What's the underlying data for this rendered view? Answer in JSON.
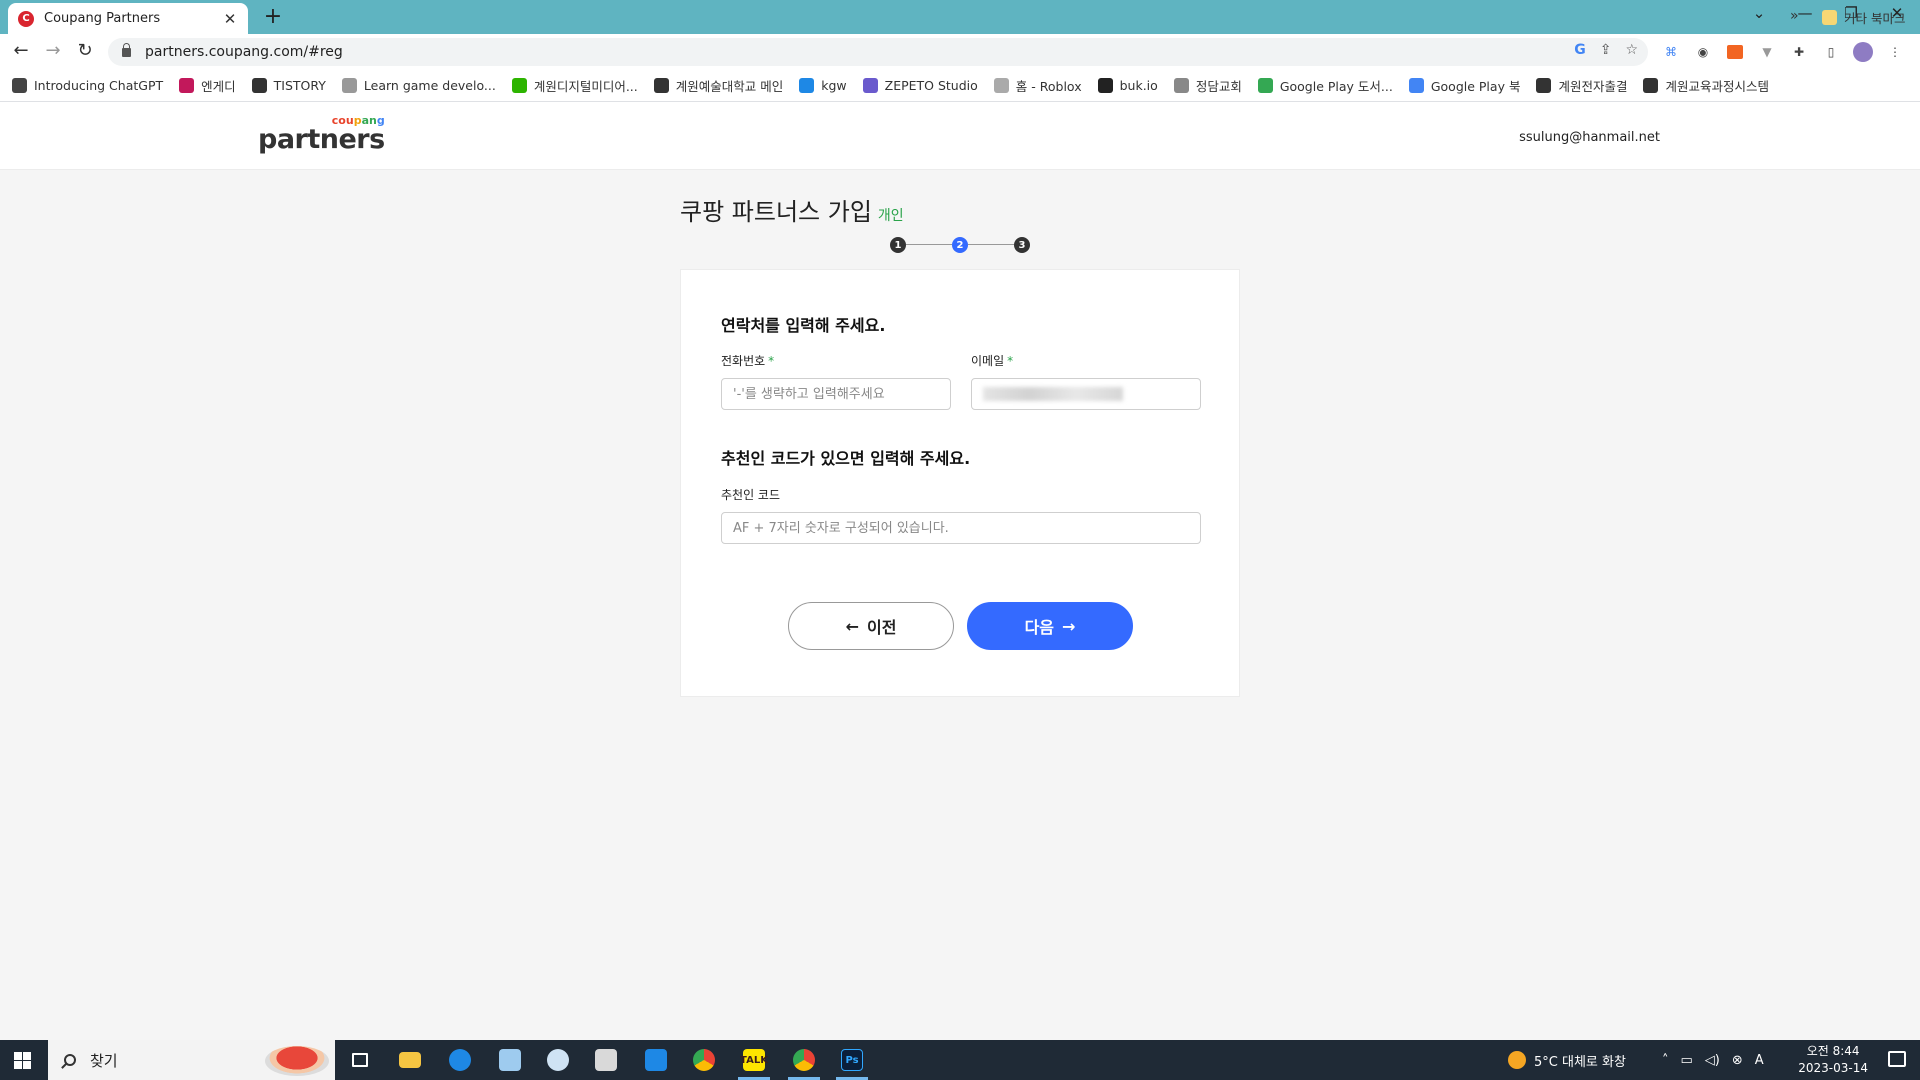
{
  "browser": {
    "tab_title": "Coupang Partners",
    "favicon_letter": "C",
    "close_symbol": "✕",
    "new_tab_symbol": "+",
    "url": "partners.coupang.com/#reg",
    "bookmarks": [
      {
        "label": "Introducing ChatGPT",
        "color": "#444"
      },
      {
        "label": "엔게디",
        "color": "#c2185b"
      },
      {
        "label": "TISTORY",
        "color": "#333"
      },
      {
        "label": "Learn game develo...",
        "color": "#999"
      },
      {
        "label": "계원디지털미디어...",
        "color": "#2db400"
      },
      {
        "label": "계원예술대학교 메인",
        "color": "#333"
      },
      {
        "label": "kgw",
        "color": "#1e88e5"
      },
      {
        "label": "ZEPETO Studio",
        "color": "#6a5acd"
      },
      {
        "label": "홈 - Roblox",
        "color": "#aaa"
      },
      {
        "label": "buk.io",
        "color": "#222"
      },
      {
        "label": "정담교회",
        "color": "#888"
      },
      {
        "label": "Google Play 도서...",
        "color": "#34a853"
      },
      {
        "label": "Google Play 북",
        "color": "#4285f4"
      },
      {
        "label": "계원전자출결",
        "color": "#333"
      },
      {
        "label": "계원교육과정시스템",
        "color": "#333"
      }
    ],
    "bookmark_more": "»",
    "other_bookmarks": "기타 북마크"
  },
  "header": {
    "logo_sub": "coupang",
    "logo_main": "partners",
    "user_email": "ssulung@hanmail.net"
  },
  "page": {
    "title": "쿠팡 파트너스 가입",
    "title_tag": "개인",
    "steps": [
      {
        "num": "1",
        "color": "#333"
      },
      {
        "num": "2",
        "color": "#346aff"
      },
      {
        "num": "3",
        "color": "#333"
      }
    ],
    "contact_heading": "연락처를 입력해 주세요.",
    "phone_label": "전화번호",
    "phone_placeholder": "'-'를 생략하고 입력해주세요",
    "phone_value": "",
    "email_label": "이메일",
    "required_mark": "*",
    "referral_heading": "추천인 코드가 있으면 입력해 주세요.",
    "referral_label": "추천인 코드",
    "referral_placeholder": "AF + 7자리 숫자로 구성되어 있습니다.",
    "referral_value": "",
    "prev_label": "이전",
    "next_label": "다음",
    "prev_arrow": "←",
    "next_arrow": "→"
  },
  "colors": {
    "brand_blue": "#346aff",
    "green": "#2aa34a",
    "tab_bar": "#5fb4c1"
  },
  "taskbar": {
    "search_label": "찾기",
    "weather": "5°C  대체로 화창",
    "time": "오전 8:44",
    "date": "2023-03-14",
    "ime": "A"
  }
}
